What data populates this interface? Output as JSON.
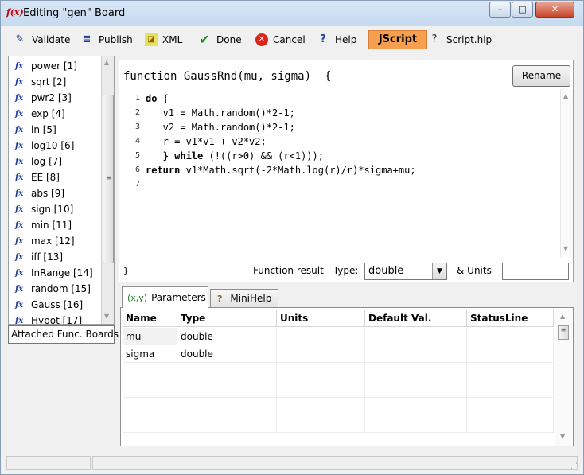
{
  "window": {
    "title": "Editing \"gen\" Board",
    "min_label": "–",
    "max_label": "□",
    "close_label": "✕"
  },
  "toolbar": {
    "validate": "Validate",
    "publish": "Publish",
    "xml": "XML",
    "done": "Done",
    "cancel": "Cancel",
    "help": "Help",
    "jscript": "JScript",
    "script_help": "Script.hlp"
  },
  "functions": [
    "power [1]",
    "sqrt [2]",
    "pwr2 [3]",
    "exp [4]",
    "ln [5]",
    "log10 [6]",
    "log [7]",
    "EE [8]",
    "abs [9]",
    "sign [10]",
    "min [11]",
    "max [12]",
    "iff [13]",
    "InRange [14]",
    "random [15]",
    "Gauss [16]",
    "Hypot [17]"
  ],
  "attached_boards_label": "Attached Func. Boards",
  "editor": {
    "signature": "function GaussRnd(mu, sigma)  {",
    "rename_label": "Rename",
    "code_lines": [
      {
        "n": "1",
        "kw": "do",
        "rest": " {"
      },
      {
        "n": "2",
        "kw": "",
        "rest": "   v1 = Math.random()*2-1;"
      },
      {
        "n": "3",
        "kw": "",
        "rest": "   v2 = Math.random()*2-1;"
      },
      {
        "n": "4",
        "kw": "",
        "rest": "   r = v1*v1 + v2*v2;"
      },
      {
        "n": "5",
        "kw": "   } while",
        "rest": " (!((r>0) && (r<1)));"
      },
      {
        "n": "6",
        "kw": "return",
        "rest": " v1*Math.sqrt(-2*Math.log(r)/r)*sigma+mu;"
      },
      {
        "n": "7",
        "kw": "",
        "rest": ""
      }
    ],
    "closing_brace": "}",
    "result_type_label": "Function result - Type:",
    "result_type": "double",
    "units_label": "& Units",
    "units_value": ""
  },
  "tabs": {
    "parameters": "Parameters",
    "parameters_icon": "(x,y)",
    "minihelp": "MiniHelp"
  },
  "grid": {
    "headers": [
      "Name",
      "Type",
      "Units",
      "Default Val.",
      "StatusLine"
    ],
    "rows": [
      [
        "mu",
        "double",
        "",
        "",
        ""
      ],
      [
        "sigma",
        "double",
        "",
        "",
        ""
      ]
    ]
  }
}
